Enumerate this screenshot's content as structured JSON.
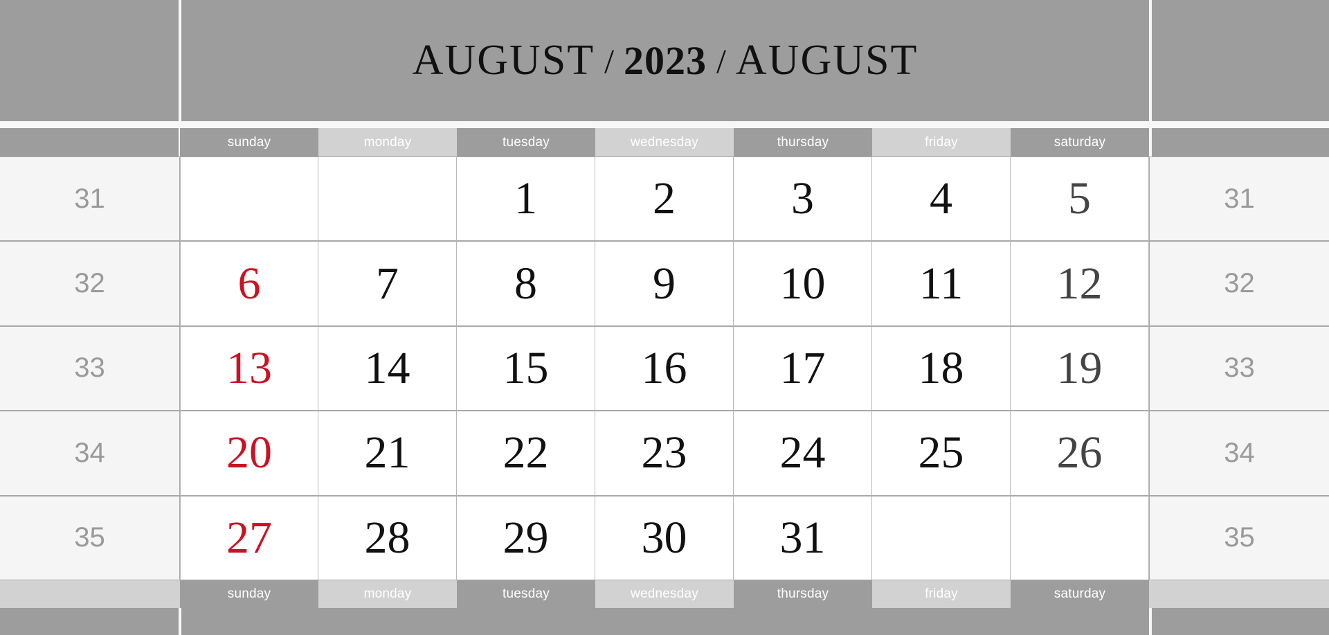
{
  "title": {
    "month_left": "AUGUST",
    "slash": "/",
    "year": "2023",
    "month_right": "AUGUST"
  },
  "weekdays": [
    {
      "label": "sunday",
      "shade": "dark"
    },
    {
      "label": "monday",
      "shade": "light"
    },
    {
      "label": "tuesday",
      "shade": "dark"
    },
    {
      "label": "wednesday",
      "shade": "light"
    },
    {
      "label": "thursday",
      "shade": "dark"
    },
    {
      "label": "friday",
      "shade": "light"
    },
    {
      "label": "saturday",
      "shade": "dark"
    }
  ],
  "colors": {
    "band_gray": "#9d9d9d",
    "weekday_light": "#d2d2d2",
    "sunday_red": "#cc1122",
    "saturday_gray": "#444444",
    "weeknum_gray": "#9a9a9a",
    "weeknum_bg": "#f5f5f5",
    "border": "#a8a8a8"
  },
  "weeks": [
    {
      "week_number": "31",
      "days": [
        "",
        "",
        "1",
        "2",
        "3",
        "4",
        "5"
      ]
    },
    {
      "week_number": "32",
      "days": [
        "6",
        "7",
        "8",
        "9",
        "10",
        "11",
        "12"
      ]
    },
    {
      "week_number": "33",
      "days": [
        "13",
        "14",
        "15",
        "16",
        "17",
        "18",
        "19"
      ]
    },
    {
      "week_number": "34",
      "days": [
        "20",
        "21",
        "22",
        "23",
        "24",
        "25",
        "26"
      ]
    },
    {
      "week_number": "35",
      "days": [
        "27",
        "28",
        "29",
        "30",
        "31",
        "",
        ""
      ]
    }
  ]
}
